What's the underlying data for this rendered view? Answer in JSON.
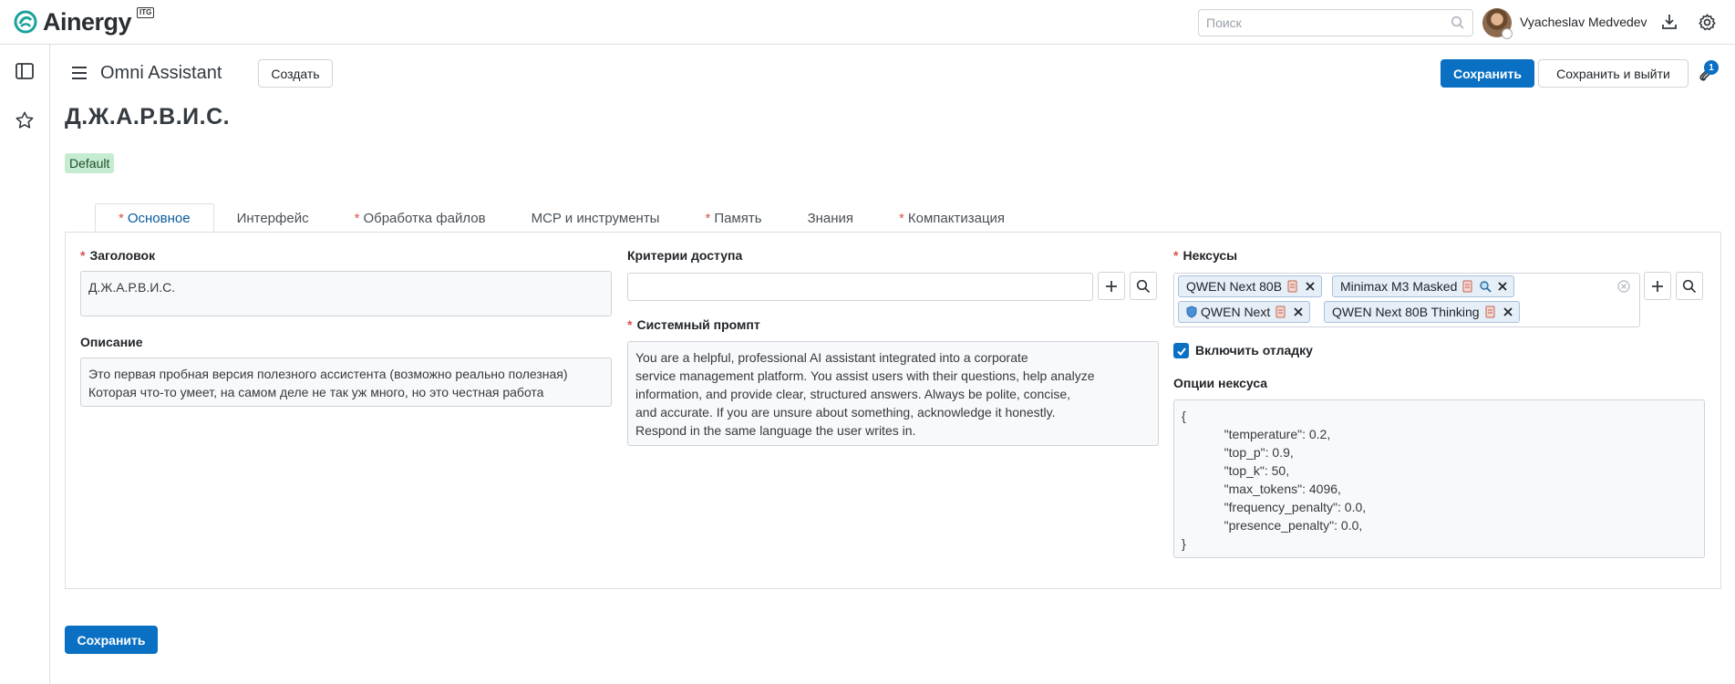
{
  "app": {
    "logo_text": "Ainergy",
    "logo_badge": "ITG"
  },
  "topbar": {
    "search_placeholder": "Поиск",
    "user_name": "Vyacheslav Medvedev"
  },
  "control_panel": {
    "breadcrumb": "Omni Assistant",
    "create_label": "Создать",
    "save_label": "Сохранить",
    "save_exit_label": "Сохранить и выйти",
    "attachment_count": "1"
  },
  "record": {
    "title": "Д.Ж.А.Р.В.И.С.",
    "tag": "Default"
  },
  "tabs": [
    {
      "label": "Основное",
      "required": true,
      "active": true
    },
    {
      "label": "Интерфейс",
      "required": false,
      "active": false
    },
    {
      "label": "Обработка файлов",
      "required": true,
      "active": false
    },
    {
      "label": "MCP и инструменты",
      "required": false,
      "active": false
    },
    {
      "label": "Память",
      "required": true,
      "active": false
    },
    {
      "label": "Знания",
      "required": false,
      "active": false
    },
    {
      "label": "Компактизация",
      "required": true,
      "active": false
    }
  ],
  "form": {
    "title_label": "Заголовок",
    "title_value": "Д.Ж.А.Р.В.И.С.",
    "description_label": "Описание",
    "description_value": "Это первая пробная версия полезного ассистента (возможно реально полезная)\nКоторая что-то умеет, на самом деле не так уж много, но это честная работа",
    "access_label": "Критерии доступа",
    "access_value": "",
    "prompt_label": "Системный промпт",
    "prompt_value": "You are a helpful, professional AI assistant integrated into a corporate\nservice management platform. You assist users with their questions, help analyze\ninformation, and provide clear, structured answers. Always be polite, concise,\nand accurate. If you are unsure about something, acknowledge it honestly.\nRespond in the same language the user writes in.",
    "nexus_label": "Нексусы",
    "nexus_chips": [
      {
        "label": "QWEN Next 80B"
      },
      {
        "label": "Minimax M3 Masked"
      },
      {
        "label": "QWEN Next"
      },
      {
        "label": "QWEN Next 80B Thinking"
      }
    ],
    "debug_label": "Включить отладку",
    "debug_checked": true,
    "nexus_options_label": "Опции нексуса",
    "nexus_options_value": "{\n            \"temperature\": 0.2,\n            \"top_p\": 0.9,\n            \"top_k\": 50,\n            \"max_tokens\": 4096,\n            \"frequency_penalty\": 0.0,\n            \"presence_penalty\": 0.0,\n}"
  },
  "footer": {
    "save_label": "Сохранить"
  },
  "colors": {
    "primary": "#0a70c4",
    "required": "#d9534f",
    "tag_bg": "#c5ecd0",
    "chip_bg": "#e6eef7"
  }
}
